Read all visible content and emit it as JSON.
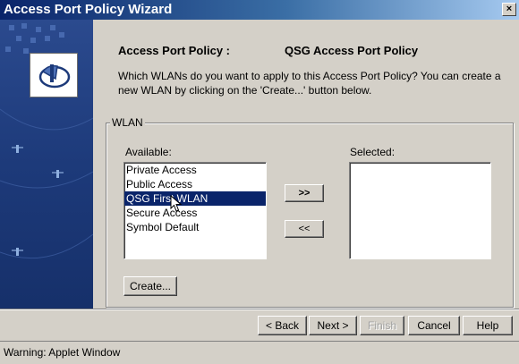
{
  "window": {
    "title": "Access Port Policy Wizard",
    "close_glyph": "×"
  },
  "header": {
    "policy_label": "Access Port Policy :",
    "policy_value": "QSG Access Port Policy",
    "description": "Which WLANs do you want to apply to this Access Port Policy? You can create a new WLAN by clicking on the 'Create...' button below."
  },
  "wlan": {
    "group_label": "WLAN",
    "available_label": "Available:",
    "selected_label": "Selected:",
    "available_items": [
      "Private Access",
      "Public Access",
      "QSG First WLAN",
      "Secure Access",
      "Symbol Default"
    ],
    "selected_index": 2,
    "add_label": ">>",
    "remove_label": "<<",
    "create_label": "Create..."
  },
  "nav": {
    "back_label": "< Back",
    "next_label": "Next >",
    "finish_label": "Finish",
    "cancel_label": "Cancel",
    "help_label": "Help"
  },
  "status": {
    "text": "Warning: Applet Window"
  },
  "colors": {
    "title_start": "#0a246a",
    "selection": "#0a246a",
    "sidebar": "#1d3a7a"
  },
  "icons": {
    "wizard": "wizard-icon",
    "close": "close-icon"
  }
}
